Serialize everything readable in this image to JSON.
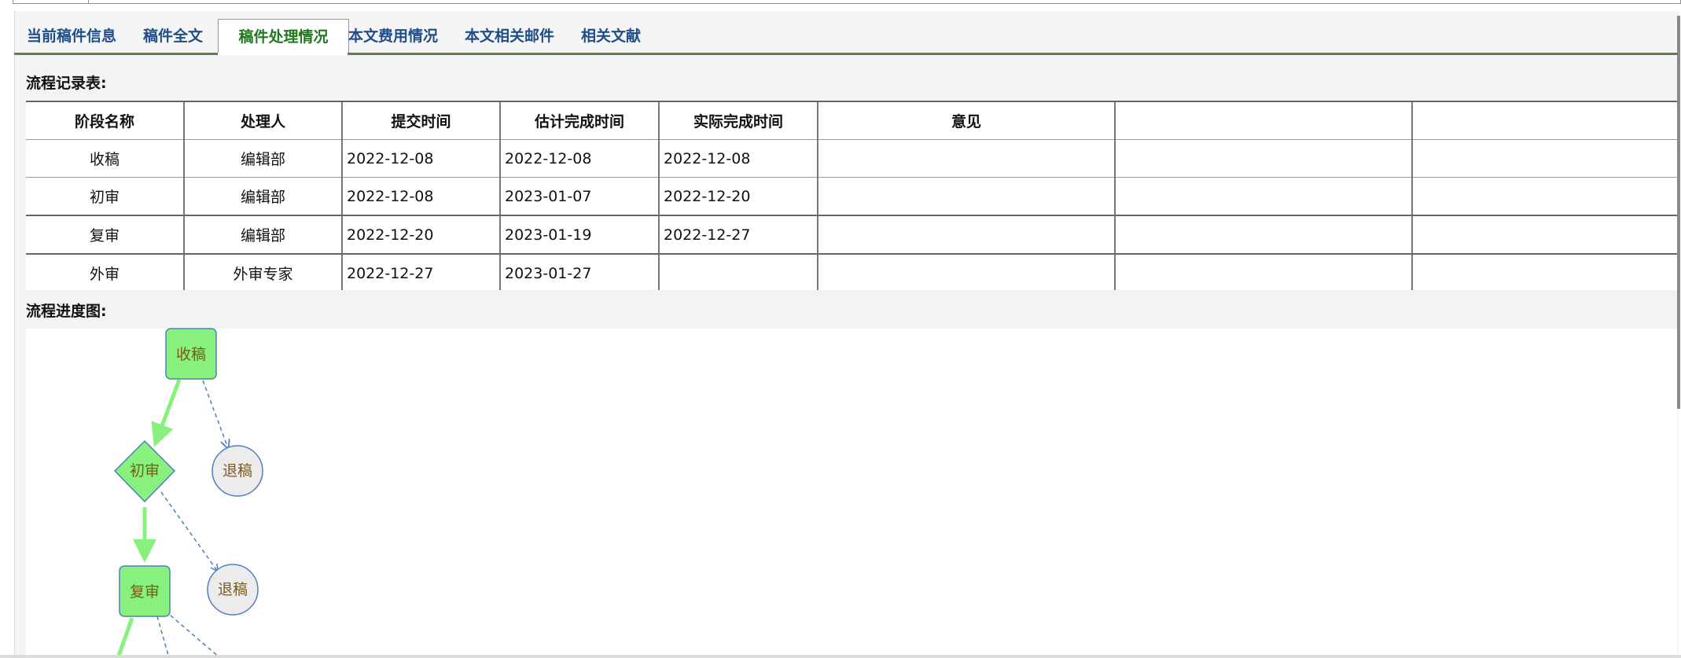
{
  "tabs": [
    {
      "label": "当前稿件信息"
    },
    {
      "label": "稿件全文"
    },
    {
      "label": "稿件处理情况"
    },
    {
      "label": "本文费用情况"
    },
    {
      "label": "本文相关邮件"
    },
    {
      "label": "相关文献"
    }
  ],
  "active_tab": "稿件处理情况",
  "record_section": {
    "title": "流程记录表:",
    "columns": [
      "阶段名称",
      "处理人",
      "提交时间",
      "估计完成时间",
      "实际完成时间",
      "意见",
      "",
      ""
    ],
    "rows": [
      [
        "收稿",
        "编辑部",
        "2022-12-08",
        "2022-12-08",
        "2022-12-08",
        "",
        "",
        ""
      ],
      [
        "初审",
        "编辑部",
        "2022-12-08",
        "2023-01-07",
        "2022-12-20",
        "",
        "",
        ""
      ],
      [
        "复审",
        "编辑部",
        "2022-12-20",
        "2023-01-19",
        "2022-12-27",
        "",
        "",
        ""
      ],
      [
        "外审",
        "外审专家",
        "2022-12-27",
        "2023-01-27",
        "",
        "",
        "",
        ""
      ]
    ]
  },
  "progress_section": {
    "title": "流程进度图:",
    "nodes": {
      "receive": "收稿",
      "first_review": "初审",
      "reject_1": "退稿",
      "second_review": "复审",
      "reject_2": "退稿"
    }
  },
  "colors": {
    "tab_text": "#1e4d8a",
    "tab_active_text": "#1f7a1f",
    "node_fill": "#88f07c",
    "node_stroke": "#4d7fc0",
    "reject_fill": "#ececec",
    "reject_text": "#7a5a1e",
    "arrow_main": "#88f07c",
    "arrow_dashed": "#4d7fc0"
  }
}
